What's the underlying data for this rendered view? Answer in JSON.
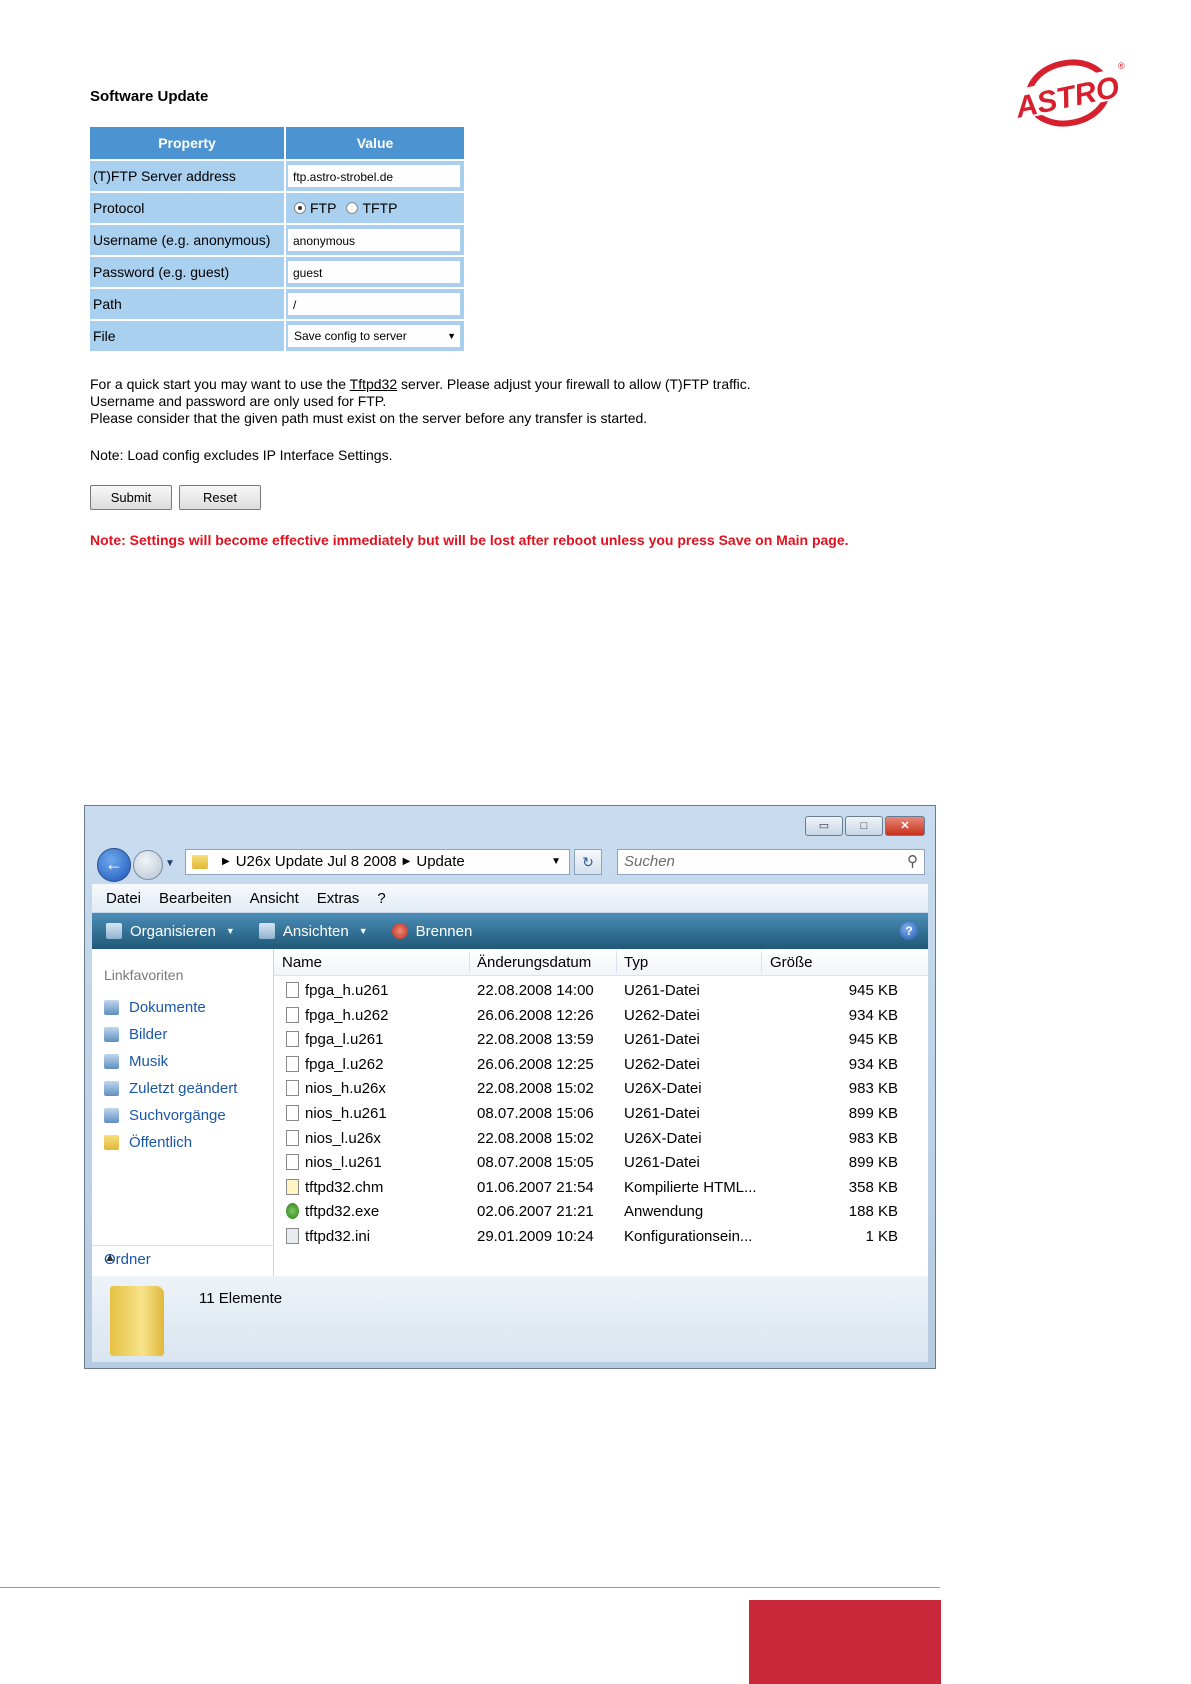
{
  "logo": {
    "text": "ASTRO",
    "mark": "®",
    "color": "#d7202e"
  },
  "form": {
    "title": "Software Update",
    "headers": {
      "property": "Property",
      "value": "Value"
    },
    "rows": {
      "server": {
        "label": "(T)FTP Server address",
        "value": "ftp.astro-strobel.de"
      },
      "protocol": {
        "label": "Protocol",
        "options": [
          "FTP",
          "TFTP"
        ],
        "selected": "FTP"
      },
      "username": {
        "label": "Username (e.g. anonymous)",
        "value": "anonymous"
      },
      "password": {
        "label": "Password (e.g. guest)",
        "value": "guest"
      },
      "path": {
        "label": "Path",
        "value": "/"
      },
      "file": {
        "label": "File",
        "value": "Save config to server"
      }
    },
    "info": {
      "line1_pre": "For a quick start you may want to use the ",
      "line1_link": "Tftpd32",
      "line1_post": " server. Please adjust your firewall to allow (T)FTP traffic.",
      "line2": "Username and password are only used for FTP.",
      "line3": "Please consider that the given path must exist on the server before any transfer is started."
    },
    "note1": "Note: Load config excludes IP Interface Settings.",
    "buttons": {
      "submit": "Submit",
      "reset": "Reset"
    },
    "note2": "Note: Settings will become effective immediately but will be lost after reboot unless you press Save on Main page.",
    "header_color": "#4c93d2",
    "row_color": "#aad0ef",
    "note2_color": "#e0121f"
  },
  "explorer": {
    "window_buttons": {
      "minimize": "▭",
      "maximize": "□",
      "close": "✕"
    },
    "address": {
      "segments": [
        "U26x Update Jul 8 2008",
        "Update"
      ]
    },
    "search_placeholder": "Suchen",
    "menu": [
      "Datei",
      "Bearbeiten",
      "Ansicht",
      "Extras",
      "?"
    ],
    "toolbar": {
      "organize": "Organisieren",
      "views": "Ansichten",
      "burn": "Brennen"
    },
    "sidebar": {
      "heading": "Linkfavoriten",
      "items": [
        "Dokumente",
        "Bilder",
        "Musik",
        "Zuletzt geändert",
        "Suchvorgänge",
        "Öffentlich"
      ],
      "folders_label": "Ordner"
    },
    "columns": {
      "name": "Name",
      "date": "Änderungsdatum",
      "type": "Typ",
      "size": "Größe"
    },
    "files": [
      {
        "name": "fpga_h.u261",
        "date": "22.08.2008 14:00",
        "type": "U261-Datei",
        "size": "945 KB",
        "icon": "file-icon"
      },
      {
        "name": "fpga_h.u262",
        "date": "26.06.2008 12:26",
        "type": "U262-Datei",
        "size": "934 KB",
        "icon": "file-icon"
      },
      {
        "name": "fpga_l.u261",
        "date": "22.08.2008 13:59",
        "type": "U261-Datei",
        "size": "945 KB",
        "icon": "file-icon"
      },
      {
        "name": "fpga_l.u262",
        "date": "26.06.2008 12:25",
        "type": "U262-Datei",
        "size": "934 KB",
        "icon": "file-icon"
      },
      {
        "name": "nios_h.u26x",
        "date": "22.08.2008 15:02",
        "type": "U26X-Datei",
        "size": "983 KB",
        "icon": "file-icon"
      },
      {
        "name": "nios_h.u261",
        "date": "08.07.2008 15:06",
        "type": "U261-Datei",
        "size": "899 KB",
        "icon": "file-icon"
      },
      {
        "name": "nios_l.u26x",
        "date": "22.08.2008 15:02",
        "type": "U26X-Datei",
        "size": "983 KB",
        "icon": "file-icon"
      },
      {
        "name": "nios_l.u261",
        "date": "08.07.2008 15:05",
        "type": "U261-Datei",
        "size": "899 KB",
        "icon": "file-icon"
      },
      {
        "name": "tftpd32.chm",
        "date": "01.06.2007 21:54",
        "type": "Kompilierte HTML...",
        "size": "358 KB",
        "icon": "help-file-icon"
      },
      {
        "name": "tftpd32.exe",
        "date": "02.06.2007 21:21",
        "type": "Anwendung",
        "size": "188 KB",
        "icon": "application-icon"
      },
      {
        "name": "tftpd32.ini",
        "date": "29.01.2009 10:24",
        "type": "Konfigurationsein...",
        "size": "1 KB",
        "icon": "settings-file-icon"
      }
    ],
    "status": "11 Elemente"
  },
  "footer": {
    "accent_color": "#c8283a"
  }
}
